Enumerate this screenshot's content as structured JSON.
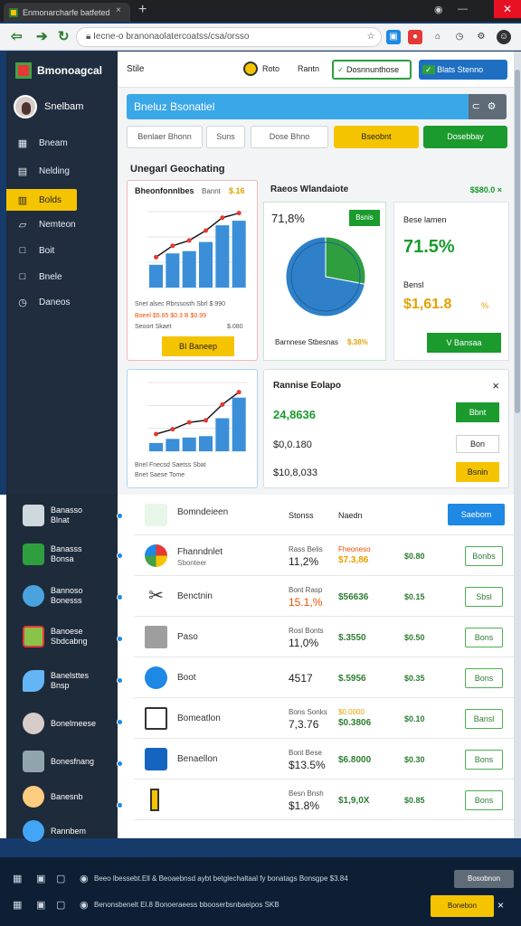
{
  "browser": {
    "tab_title": "Enmonarcharfe batfeted",
    "tab_close": "×",
    "new_tab": "+",
    "url": "Iecne-o branonaolatercoatss/csa/orsso",
    "back_icon": "arrow-left-icon",
    "forward_icon": "arrow-right-icon",
    "reload_icon": "reload-icon"
  },
  "sidebar": {
    "brand": "Bmonoagcal",
    "user_name": "Snelbam",
    "items": [
      {
        "label": "Bneam",
        "icon": "grid-icon"
      },
      {
        "label": "Nelding",
        "icon": "calendar-icon"
      },
      {
        "label": "Bolds",
        "icon": "chart-icon"
      },
      {
        "label": "Nemteon",
        "icon": "document-icon"
      },
      {
        "label": "Boit",
        "icon": "square-icon"
      },
      {
        "label": "Bnele",
        "icon": "square-icon"
      },
      {
        "label": "Daneos",
        "icon": "clock-icon"
      }
    ]
  },
  "topbar": {
    "left_label": "Stile",
    "center1": "Roto",
    "center2": "Rantn",
    "field_value": "Dosnnunthose",
    "primary_button": "Blats Stenno"
  },
  "banner": {
    "title": "Bneluz Bsonatiel"
  },
  "filters": {
    "f1": "Benlaer Bhonn",
    "f2": "Suns",
    "f3": "Dose Bhno",
    "yellow_btn": "Bseobnt",
    "green_btn": "Dosebbay"
  },
  "section_title": "Unegarl Geochating",
  "card1": {
    "title": "Bheonfonnlbes",
    "badge_label": "Bannt",
    "badge_value": "$.16",
    "line1": "Snet alsec  Rbrssosth  Sbrl  $.990",
    "line2": "Boeel  $5.85  $0.3 B $0.99",
    "line3": "Seoort Skaet",
    "line3_value": "$.080",
    "button": "BI Baneep"
  },
  "card2": {
    "title": "Raeos Wlandaiote",
    "right_value": "$$80.0 ×",
    "percent": "71,8%",
    "badge": "Bsnis",
    "footer": "Barnnese Stbesnas",
    "footer_value": "$.38%",
    "chart_values": [
      28,
      72
    ]
  },
  "card3": {
    "label": "Bese lamen",
    "big_percent": "71.5%",
    "label2": "Bensl",
    "value": "$1,61.8",
    "unit": "%",
    "button": "V Bansaa"
  },
  "card4": {
    "line1": "Bnel  Fnecsd  Saetss  Sbat",
    "line2": "Bnet  Saese  Tome"
  },
  "card5": {
    "title": "Rannise Eolapo",
    "close": "×",
    "v1": "24,8636",
    "b1": "Bbnt",
    "v2": "$0,0.180",
    "b2": "Bon",
    "v3": "$10,8,033",
    "b3": "Bsnin"
  },
  "list": {
    "header": {
      "name": "Bomndeieen",
      "c1": "Stonss",
      "c2": "Naedn",
      "button": "Saebom"
    },
    "rows": [
      {
        "name": "Fhanndnlet",
        "sub": "Sbonteer",
        "c1": "Rass Belis",
        "v1": "11,2%",
        "c2": "Fheoneso",
        "v2": "$7.3,86",
        "v3": "$0.80",
        "btn": "Bonbs"
      },
      {
        "name": "Benctnin",
        "sub": "",
        "c1": "Bont Rasp",
        "v1": "15.1,%",
        "c2": "",
        "v2": "$56636",
        "v3": "$0.15",
        "btn": "Sbsl"
      },
      {
        "name": "Paso",
        "sub": "",
        "c1": "Rosl Bonts",
        "v1": "11,0%",
        "c2": "",
        "v2": "$.3550",
        "v3": "$0.50",
        "btn": "Bons"
      },
      {
        "name": "Boot",
        "sub": "",
        "c1": "",
        "v1": "4517",
        "c2": "",
        "v2": "$.5956",
        "v3": "$0.35",
        "btn": "Bons"
      },
      {
        "name": "Bomeatlon",
        "sub": "",
        "c1": "Bons Sonks",
        "v1": "7,3.76",
        "c2": "$0,0000",
        "v2": "$0.3806",
        "v3": "$0.10",
        "btn": "Bansl"
      },
      {
        "name": "Benaellon",
        "sub": "",
        "c1": "Bont Bese",
        "v1": "$13.5%",
        "c2": "",
        "v2": "$6.8000",
        "v3": "$0.30",
        "btn": "Bons"
      },
      {
        "name": "",
        "sub": "",
        "c1": "Besn Bnsh",
        "v1": "$1.8%",
        "c2": "",
        "v2": "$1,9,0X",
        "v3": "$0.85",
        "btn": "Bons"
      }
    ]
  },
  "left_list": [
    {
      "title": "Banasso",
      "sub": "Blnat"
    },
    {
      "title": "Banasss",
      "sub": "Bonsa"
    },
    {
      "title": "Bannoso",
      "sub": "Bonesss"
    },
    {
      "title": "Banoese",
      "sub": "Sbdcabng"
    },
    {
      "title": "Banelsttes",
      "sub": "Bnsp"
    },
    {
      "title": "Bonelmeese",
      "sub": ""
    },
    {
      "title": "Bonesfnang",
      "sub": ""
    },
    {
      "title": "Banesnb",
      "sub": ""
    },
    {
      "title": "Rannbem",
      "sub": ""
    }
  ],
  "bottom": {
    "row1_text": "Beeo lbessebt.Ell & Beoaebnsd aybt betglechaltaal fy bonatags Bonsgpe $3.84",
    "row1_button": "Bosobnon",
    "row2_text": "Benonsbenelt El.8 Bonoeraeess bbooserbsnbaeipos SKB",
    "row2_button": "Bonebon"
  },
  "chart_data": [
    {
      "type": "bar",
      "categories": [
        "1",
        "2",
        "3",
        "4",
        "5",
        "6"
      ],
      "values": [
        30,
        45,
        48,
        60,
        82,
        88
      ],
      "line": [
        40,
        55,
        62,
        75,
        92,
        98
      ],
      "ylim": [
        0,
        100
      ]
    },
    {
      "type": "pie",
      "values": [
        28,
        72
      ],
      "colors": [
        "#2e9e3f",
        "#2f80c9"
      ]
    },
    {
      "type": "bar",
      "categories": [
        "1",
        "2",
        "3",
        "4",
        "5",
        "6"
      ],
      "values": [
        12,
        18,
        20,
        22,
        48,
        78
      ],
      "line": [
        25,
        32,
        42,
        45,
        68,
        86
      ],
      "ylim": [
        0,
        100
      ]
    }
  ],
  "colors": {
    "accent": "#3aa7e8",
    "green": "#1b9b2d",
    "yellow": "#f5c400",
    "dark": "#1f2d3e"
  }
}
